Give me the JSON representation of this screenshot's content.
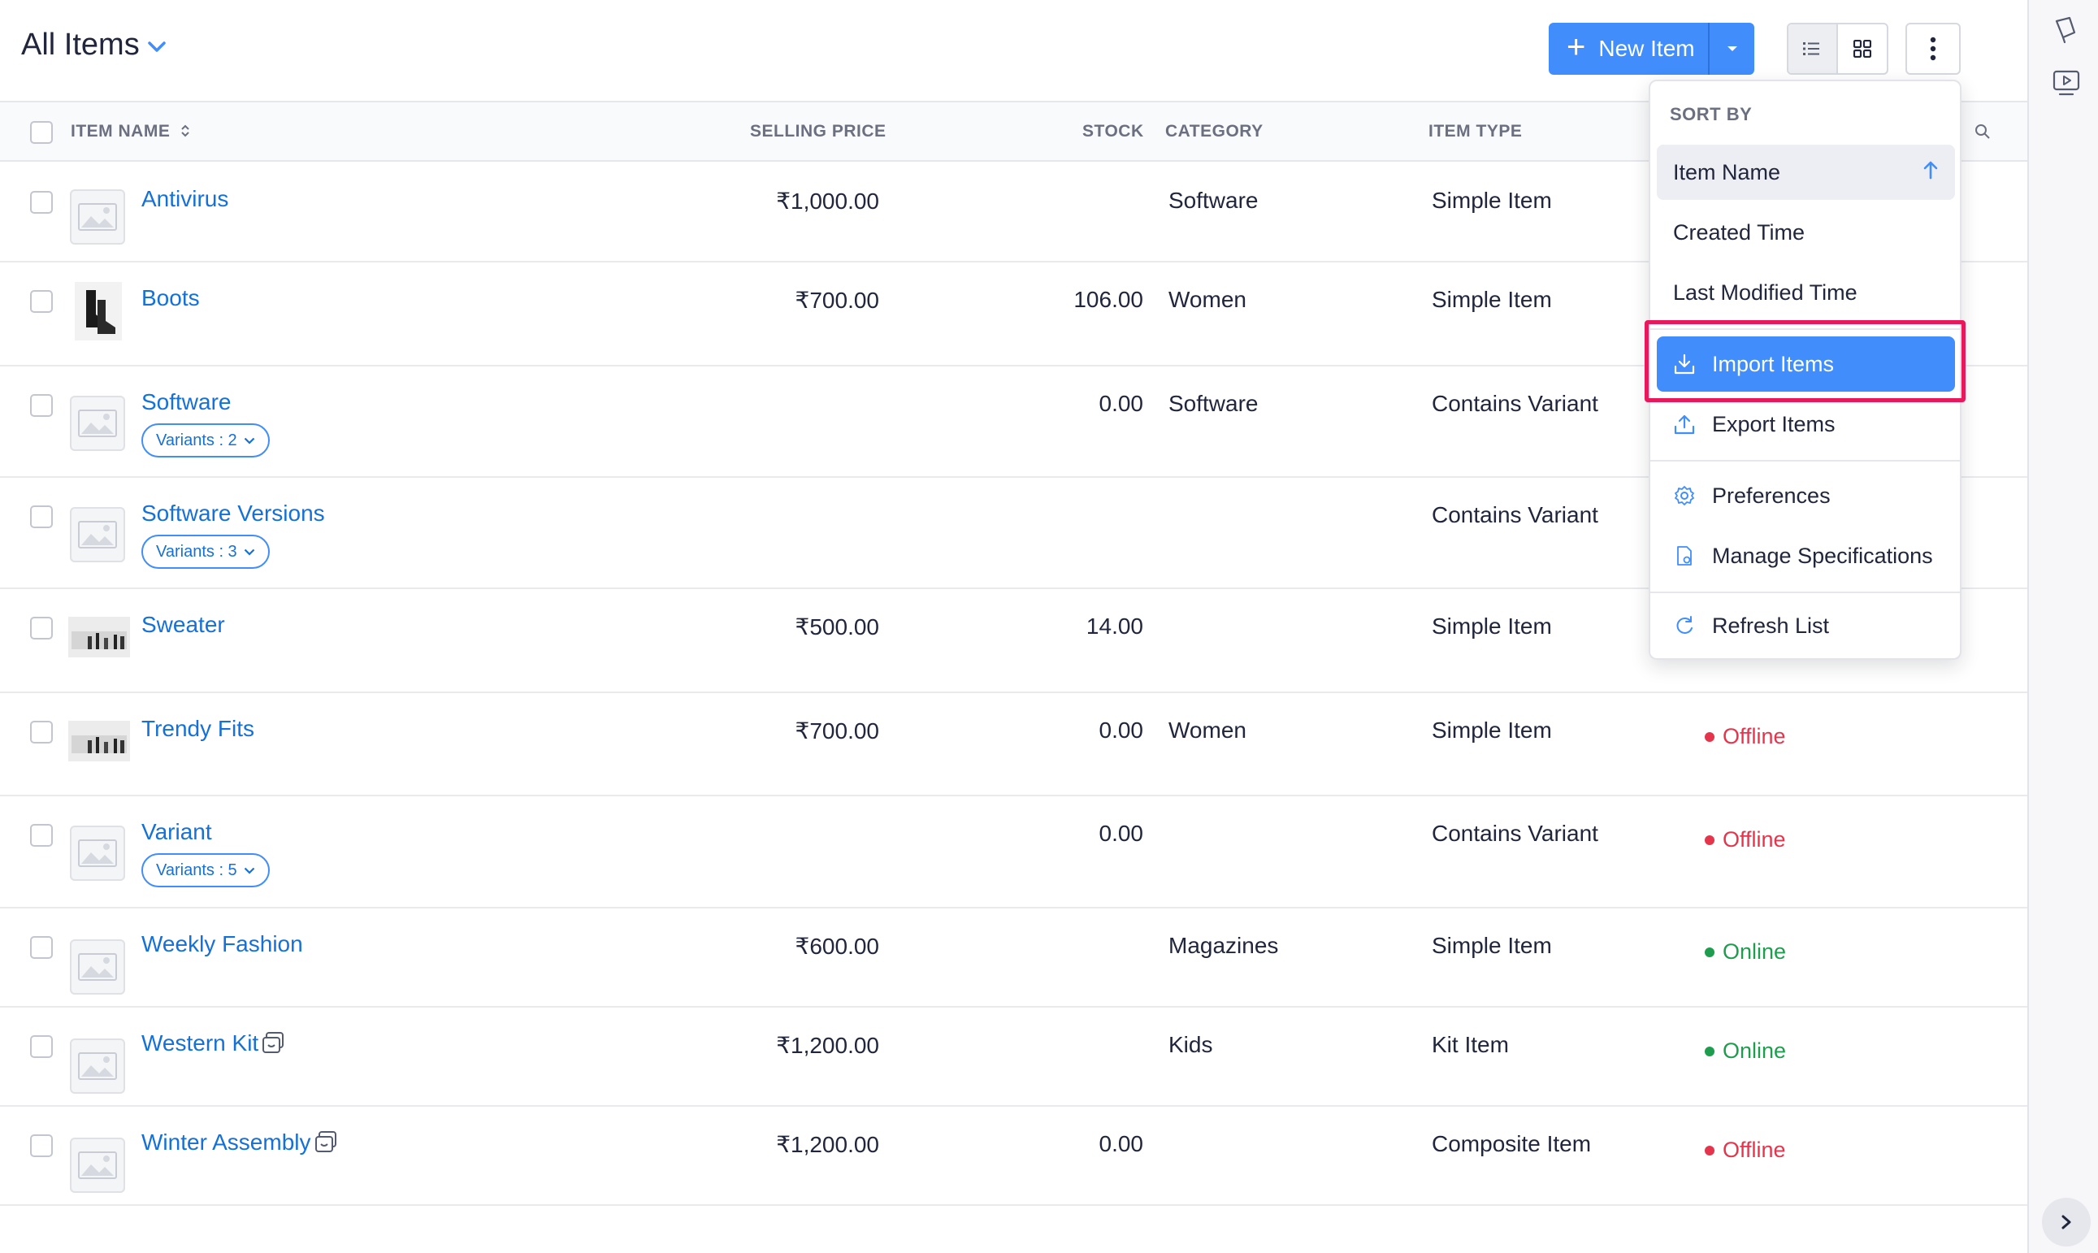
{
  "header": {
    "title": "All Items",
    "new_item_label": "New Item"
  },
  "table": {
    "columns": [
      "ITEM NAME",
      "SELLING PRICE",
      "STOCK",
      "CATEGORY",
      "ITEM TYPE"
    ],
    "rows": [
      {
        "name": "Antivirus",
        "price": "₹1,000.00",
        "stock": "",
        "category": "Software",
        "type": "Simple Item",
        "status": "",
        "variants": "",
        "thumb": "placeholder"
      },
      {
        "name": "Boots",
        "price": "₹700.00",
        "stock": "106.00",
        "category": "Women",
        "type": "Simple Item",
        "status": "",
        "variants": "",
        "thumb": "boots"
      },
      {
        "name": "Software",
        "price": "",
        "stock": "0.00",
        "category": "Software",
        "type": "Contains Variant",
        "status": "",
        "variants": "Variants : 2",
        "thumb": "placeholder"
      },
      {
        "name": "Software Versions",
        "price": "",
        "stock": "",
        "category": "",
        "type": "Contains Variant",
        "status": "",
        "variants": "Variants : 3",
        "thumb": "placeholder"
      },
      {
        "name": "Sweater",
        "price": "₹500.00",
        "stock": "14.00",
        "category": "",
        "type": "Simple Item",
        "status": "",
        "variants": "",
        "thumb": "clothes"
      },
      {
        "name": "Trendy Fits",
        "price": "₹700.00",
        "stock": "0.00",
        "category": "Women",
        "type": "Simple Item",
        "status": "Offline",
        "variants": "",
        "thumb": "clothes"
      },
      {
        "name": "Variant",
        "price": "",
        "stock": "0.00",
        "category": "",
        "type": "Contains Variant",
        "status": "Offline",
        "variants": "Variants : 5",
        "thumb": "placeholder"
      },
      {
        "name": "Weekly Fashion",
        "price": "₹600.00",
        "stock": "",
        "category": "Magazines",
        "type": "Simple Item",
        "status": "Online",
        "variants": "",
        "thumb": "placeholder"
      },
      {
        "name": "Western Kit",
        "price": "₹1,200.00",
        "stock": "",
        "category": "Kids",
        "type": "Kit Item",
        "status": "Online",
        "variants": "",
        "thumb": "placeholder"
      },
      {
        "name": "Winter Assembly",
        "price": "₹1,200.00",
        "stock": "0.00",
        "category": "",
        "type": "Composite Item",
        "status": "Offline",
        "variants": "",
        "thumb": "placeholder"
      }
    ]
  },
  "menu": {
    "sort_heading": "SORT BY",
    "sort_items": [
      "Item Name",
      "Created Time",
      "Last Modified Time"
    ],
    "import_label": "Import Items",
    "export_label": "Export Items",
    "preferences_label": "Preferences",
    "manage_specs_label": "Manage Specifications",
    "refresh_label": "Refresh List"
  },
  "colors": {
    "accent": "#408dfb",
    "link": "#1570d8",
    "offline": "#e5354c",
    "online": "#1f9d4e",
    "highlight": "#e8185a"
  }
}
